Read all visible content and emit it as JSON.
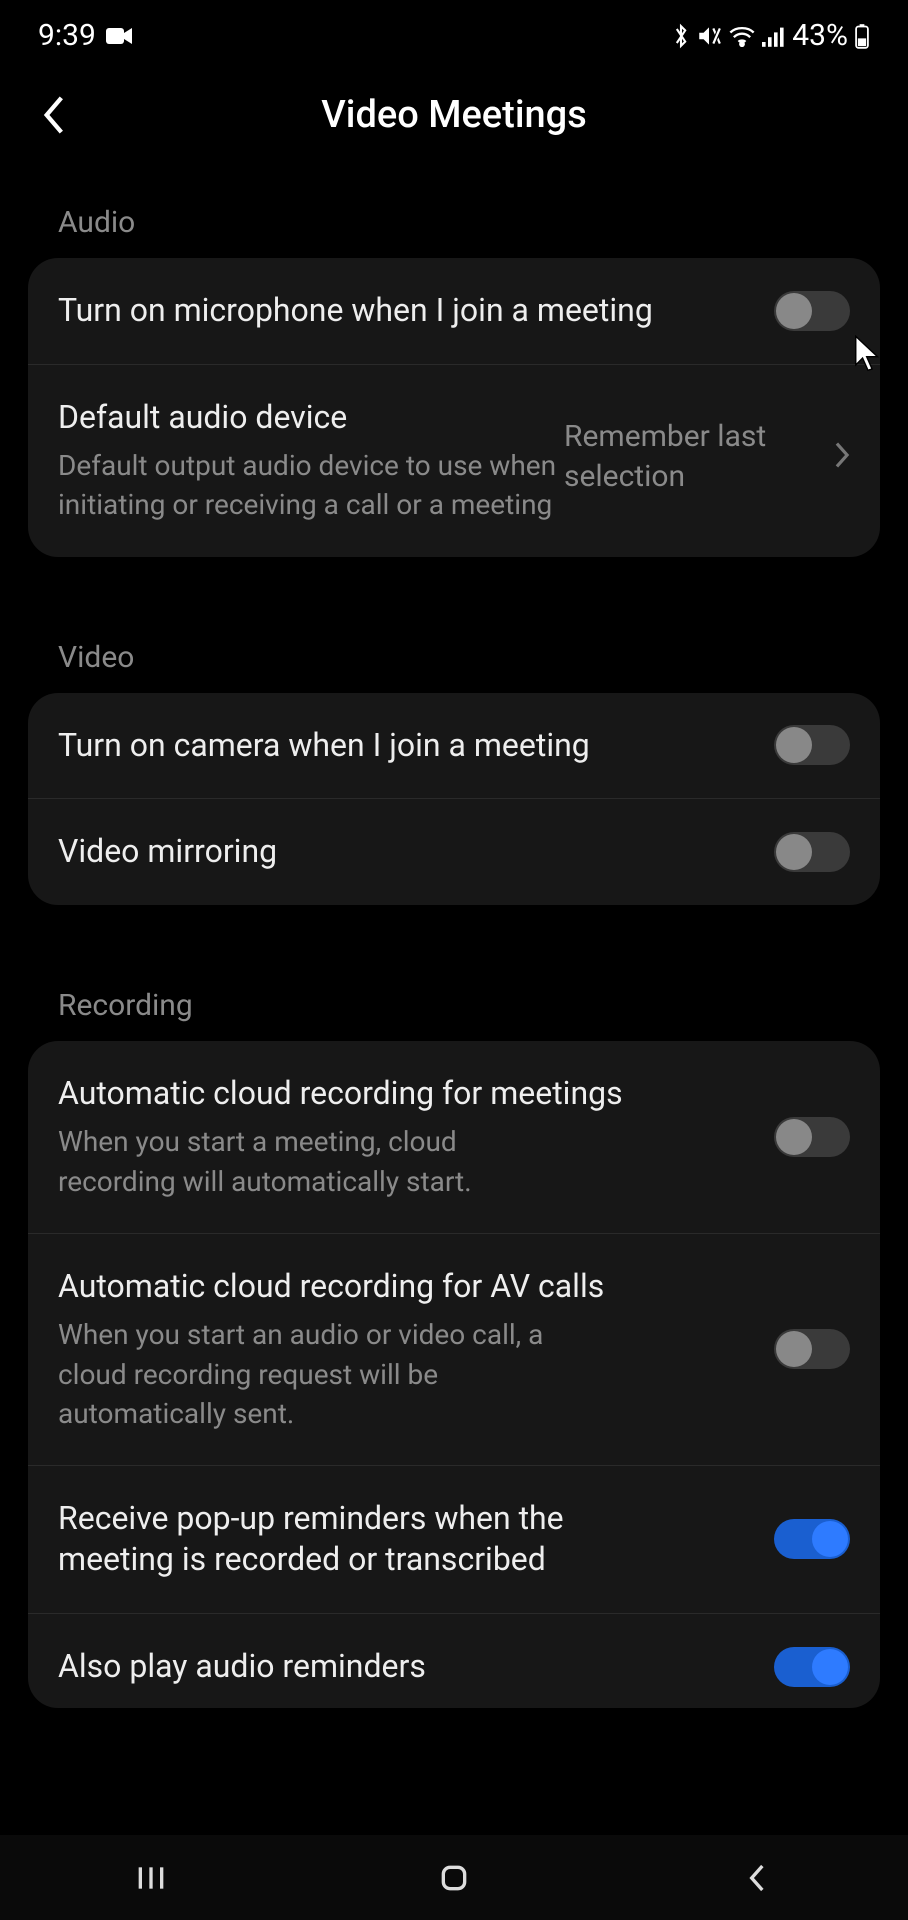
{
  "status": {
    "time": "9:39",
    "battery": "43%"
  },
  "header": {
    "title": "Video Meetings"
  },
  "sections": {
    "audio": {
      "label": "Audio",
      "items": {
        "mic_on_join": {
          "title": "Turn on microphone when I join a meeting"
        },
        "default_audio": {
          "title": "Default audio device",
          "subtitle": "Default output audio device to use when initiating or receiving a call or a meeting",
          "value": "Remember last selection"
        }
      }
    },
    "video": {
      "label": "Video",
      "items": {
        "camera_on_join": {
          "title": "Turn on camera when I join a meeting"
        },
        "mirroring": {
          "title": "Video mirroring"
        }
      }
    },
    "recording": {
      "label": "Recording",
      "items": {
        "auto_cloud_meetings": {
          "title": "Automatic cloud recording for meetings",
          "subtitle": "When you start a meeting, cloud recording will automatically start."
        },
        "auto_cloud_av": {
          "title": "Automatic cloud recording for AV calls",
          "subtitle": "When you start an audio or video call, a cloud recording request will be automatically sent."
        },
        "popup_reminders": {
          "title": "Receive pop-up reminders when the meeting is recorded or transcribed"
        },
        "audio_reminders": {
          "title": "Also play audio reminders"
        }
      }
    }
  },
  "toggles": {
    "mic_on_join": false,
    "camera_on_join": false,
    "mirroring": false,
    "auto_cloud_meetings": false,
    "auto_cloud_av": false,
    "popup_reminders": true,
    "audio_reminders": true
  }
}
